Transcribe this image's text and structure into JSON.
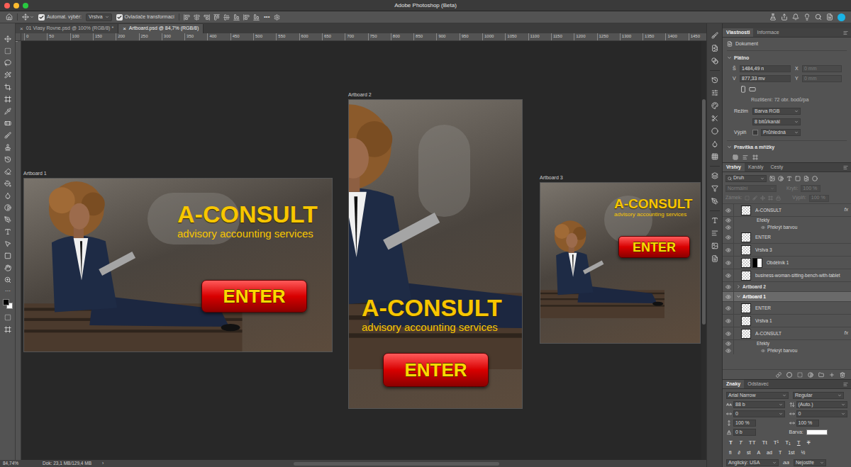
{
  "window": {
    "title": "Adobe Photoshop (Beta)"
  },
  "options_bar": {
    "auto_select": {
      "label": "Automat. výběr:",
      "checked": true
    },
    "target": "Vrstva",
    "transform": {
      "label": "Ovladače transformací",
      "checked": true
    },
    "more": "•••"
  },
  "doc_tabs": [
    {
      "label": "01 Vlasy Rovne.psd @ 100% (RGB/8) *",
      "close": "×",
      "selected": false
    },
    {
      "label": "Artboard.psd @ 84,7% (RGB/8)",
      "close": "×",
      "selected": true
    }
  ],
  "toolbar": {
    "foreground": "#000000",
    "background": "#ffffff"
  },
  "ruler": {
    "marks": [
      "0",
      "50",
      "100",
      "150",
      "200",
      "250",
      "300",
      "350",
      "400",
      "450",
      "500",
      "550",
      "600",
      "650",
      "700",
      "750",
      "800",
      "850",
      "900",
      "950",
      "1000",
      "1050",
      "1100",
      "1150",
      "1200",
      "1250",
      "1300",
      "1350",
      "1400",
      "1450"
    ]
  },
  "artboards": [
    {
      "label": "Artboard 1",
      "title": "A-CONSULT",
      "subtitle": "advisory accounting services",
      "button": "ENTER"
    },
    {
      "label": "Artboard 2",
      "title": "A-CONSULT",
      "subtitle": "advisory accounting services",
      "button": "ENTER"
    },
    {
      "label": "Artboard 3",
      "title": "A-CONSULT",
      "subtitle": "advisory accounting services",
      "button": "ENTER"
    }
  ],
  "status_bar": {
    "zoom": "84,74%",
    "document": "Dok: 23,1 MB/129,4 MB",
    "arrow": "›"
  },
  "properties": {
    "tabs": [
      {
        "label": "Vlastnosti",
        "selected": true
      },
      {
        "label": "Informace",
        "selected": false
      }
    ],
    "kind": "Dokument",
    "canvas": {
      "title": "Plátno",
      "expanded": true,
      "fields": [
        {
          "label": "Š",
          "value": "1484,49 n",
          "disabled": false
        },
        {
          "label": "X",
          "value": "0 mm",
          "disabled": true
        },
        {
          "label": "V",
          "value": "877,33 mv",
          "disabled": false
        },
        {
          "label": "Y",
          "value": "0 mm",
          "disabled": true
        }
      ]
    },
    "resolution": "Rozlišení: 72 obr. bodů/pa",
    "mode": {
      "label": "Režim",
      "value": "Barva RGB"
    },
    "depth": "8 bitů/kanál",
    "fill": {
      "label": "Výplň",
      "value": "Průhledná"
    },
    "rulers": {
      "title": "Pravítka a mřížky",
      "expanded": true
    }
  },
  "layers": {
    "tabs": [
      {
        "label": "Vrstvy",
        "selected": true
      },
      {
        "label": "Kanály",
        "selected": false
      },
      {
        "label": "Cesty",
        "selected": false
      }
    ],
    "filter": "Druh",
    "blend_mode": "Normální",
    "opacity": {
      "label": "Krytí:",
      "value": "100 %"
    },
    "lock_label": "Zámek:",
    "fill": {
      "label": "Výplň:",
      "value": "100 %"
    },
    "controls_disabled": true,
    "items": [
      {
        "name": "A-CONSULT",
        "kind": "layer",
        "visible": true,
        "selected": false,
        "badge": "fx",
        "mask": false
      },
      {
        "name": "Efekty",
        "kind": "effects",
        "visible": true,
        "selected": false
      },
      {
        "name": "Překrýt barvou",
        "kind": "effect",
        "visible": true,
        "selected": false
      },
      {
        "name": "ENTER",
        "kind": "layer",
        "visible": true,
        "selected": false,
        "badge": "",
        "mask": false
      },
      {
        "name": "Vrstva 3",
        "kind": "layer",
        "visible": true,
        "selected": false,
        "badge": "",
        "mask": false
      },
      {
        "name": "Obdélník 1",
        "kind": "layer",
        "visible": true,
        "selected": false,
        "badge": "",
        "mask": true
      },
      {
        "name": "business-woman-sitting-bench-with-tablet",
        "kind": "layer",
        "visible": true,
        "selected": false,
        "badge": "",
        "mask": false
      },
      {
        "name": "Artboard 2",
        "kind": "artboard",
        "visible": true,
        "selected": false,
        "expanded": false
      },
      {
        "name": "Artboard 1",
        "kind": "artboard",
        "visible": true,
        "selected": true,
        "expanded": true
      },
      {
        "name": "ENTER",
        "kind": "layer",
        "visible": true,
        "selected": false,
        "badge": "",
        "mask": false
      },
      {
        "name": "Vrstva 1",
        "kind": "layer",
        "visible": true,
        "selected": false,
        "badge": "",
        "mask": false
      },
      {
        "name": "A-CONSULT",
        "kind": "layer",
        "visible": true,
        "selected": false,
        "badge": "fx",
        "mask": false
      },
      {
        "name": "Efekty",
        "kind": "effects",
        "visible": true,
        "selected": false
      },
      {
        "name": "Překrýt barvou",
        "kind": "effect",
        "visible": true,
        "selected": false
      }
    ]
  },
  "character": {
    "tabs": [
      {
        "label": "Znaky",
        "selected": true
      },
      {
        "label": "Odstavec",
        "selected": false
      }
    ],
    "font": "Arial Narrow",
    "style": "Regular",
    "size": "88 b",
    "leading": "(Auto.)",
    "kerning": "0",
    "tracking": "0",
    "vertical_scale": "100 %",
    "horizontal_scale": "100 %",
    "baseline": "0 b",
    "color_label": "Barva:",
    "color": "#ffffff",
    "styles": [
      {
        "glyph": "T",
        "kind": "bold"
      },
      {
        "glyph": "T",
        "kind": "italic"
      },
      {
        "glyph": "TT",
        "kind": "caps"
      },
      {
        "glyph": "Tt",
        "kind": "smallcaps"
      },
      {
        "glyph": "T¹",
        "kind": "super"
      },
      {
        "glyph": "T₁",
        "kind": "sub"
      },
      {
        "glyph": "T",
        "kind": "underline"
      },
      {
        "glyph": "T",
        "kind": "strike"
      }
    ],
    "opentype": [
      "fi",
      "∂",
      "st",
      "A",
      "ad",
      "T",
      "1st",
      "½"
    ],
    "language": "Anglický: USA",
    "antialias_icon": "aa",
    "antialias": "Nejostře"
  }
}
